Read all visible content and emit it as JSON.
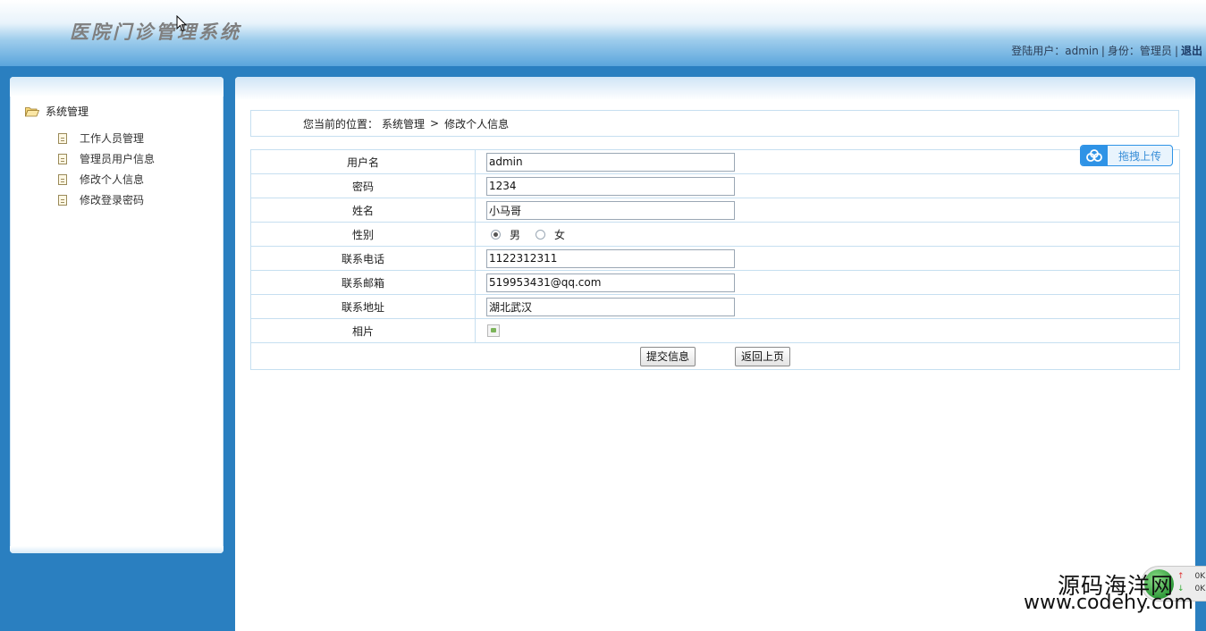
{
  "header": {
    "logo_text": "医院门诊管理系统",
    "user_label": "登陆用户：",
    "username": "admin",
    "role_label": "身份：",
    "role": "管理员",
    "logout": "退出"
  },
  "sidebar": {
    "group_label": "系统管理",
    "items": [
      {
        "label": "工作人员管理"
      },
      {
        "label": "管理员用户信息"
      },
      {
        "label": "修改个人信息"
      },
      {
        "label": "修改登录密码"
      }
    ]
  },
  "breadcrumb": {
    "prefix": "您当前的位置：",
    "section": "系统管理",
    "arrow": ">",
    "page": "修改个人信息"
  },
  "form": {
    "username_label": "用户名",
    "username_value": "admin",
    "password_label": "密码",
    "password_value": "1234",
    "name_label": "姓名",
    "name_value": "小马哥",
    "gender_label": "性别",
    "gender_male": "男",
    "gender_female": "女",
    "phone_label": "联系电话",
    "phone_value": "1122312311",
    "email_label": "联系邮箱",
    "email_value": "519953431@qq.com",
    "address_label": "联系地址",
    "address_value": "湖北武汉",
    "photo_label": "相片",
    "submit_label": "提交信息",
    "back_label": "返回上页"
  },
  "upload": {
    "label": "拖拽上传"
  },
  "watermark": {
    "cn": "源码海洋网",
    "url": "www.codehy.com"
  },
  "net_widget": {
    "up": "0K",
    "down": "0K"
  },
  "colors": {
    "frame_blue": "#2a7fc0",
    "upload_blue": "#2f93e6",
    "border_light": "#c6dff0"
  }
}
